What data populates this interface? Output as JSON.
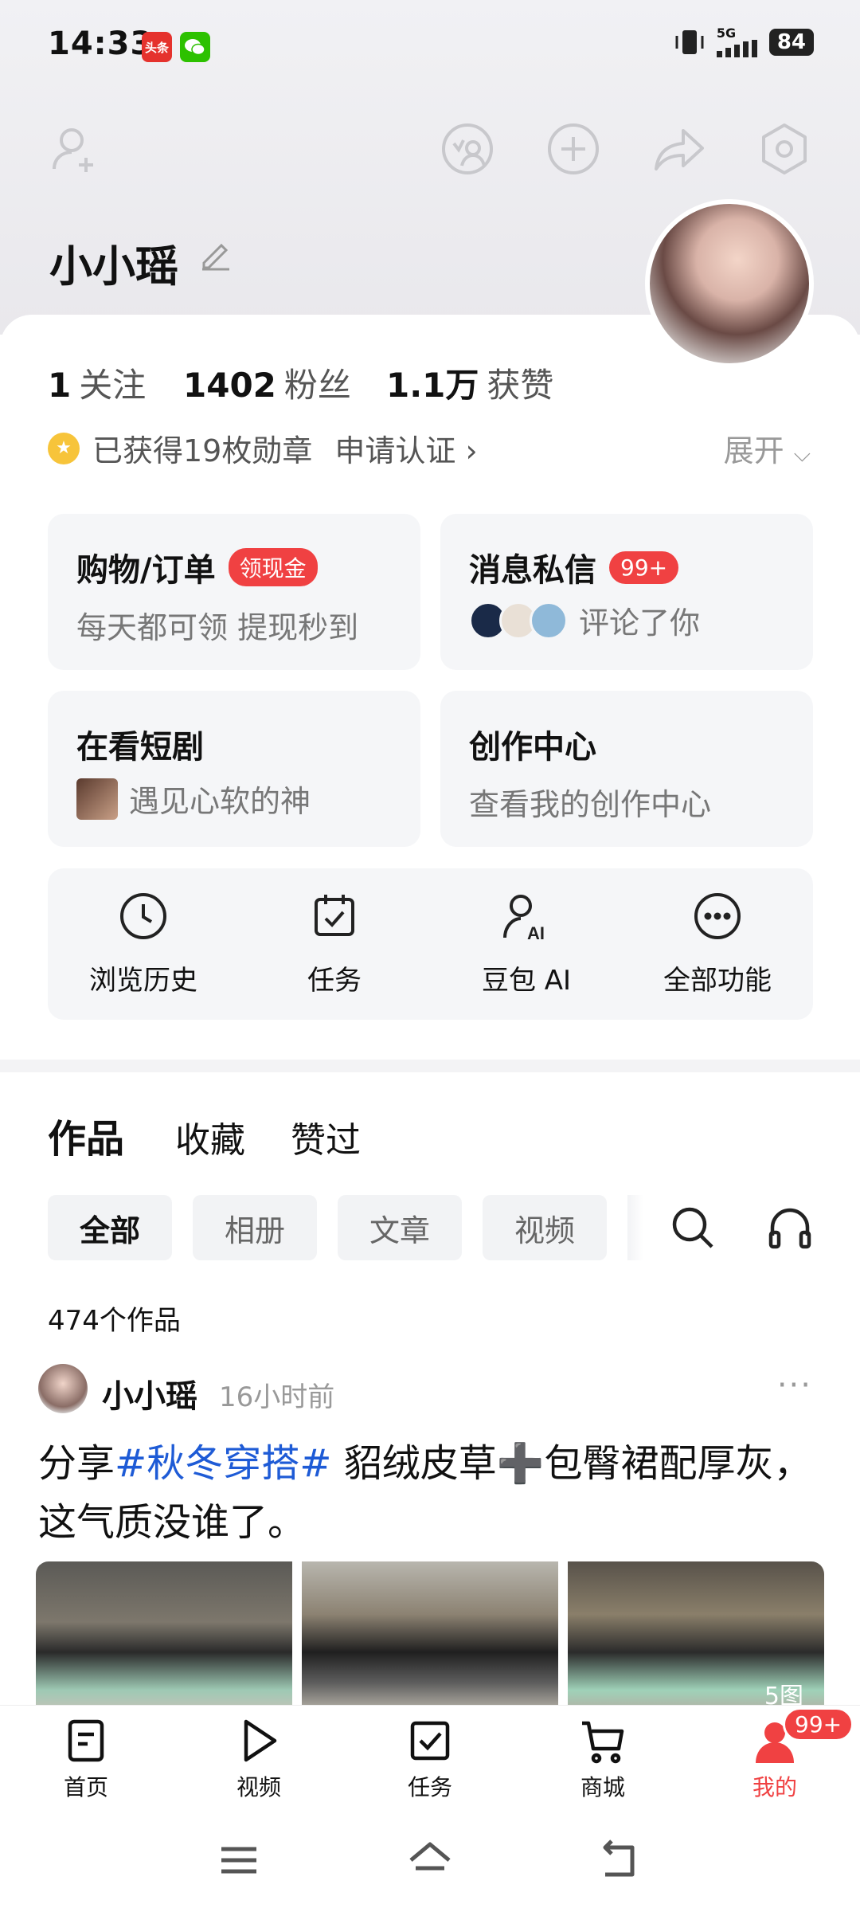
{
  "status": {
    "time": "14:33",
    "network": "5G",
    "battery": "84",
    "app1": "头条"
  },
  "profile": {
    "name": "小小瑶",
    "following": {
      "value": "1",
      "label": "关注"
    },
    "followers": {
      "value": "1402",
      "label": "粉丝"
    },
    "likes": {
      "value": "1.1万",
      "label": "获赞"
    },
    "badges_text": "已获得19枚勋章",
    "verify_text": "申请认证 ›",
    "expand_text": "展开"
  },
  "tiles": [
    {
      "title": "购物/订单",
      "tag": "领现金",
      "sub": "每天都可领 提现秒到"
    },
    {
      "title": "消息私信",
      "tag": "99+",
      "sub": "评论了你"
    },
    {
      "title": "在看短剧",
      "sub": "遇见心软的神"
    },
    {
      "title": "创作中心",
      "sub": "查看我的创作中心"
    }
  ],
  "functions": [
    {
      "label": "浏览历史",
      "icon": "clock-icon"
    },
    {
      "label": "任务",
      "icon": "calendar-check-icon"
    },
    {
      "label": "豆包 AI",
      "icon": "ai-person-icon"
    },
    {
      "label": "全部功能",
      "icon": "more-circle-icon"
    }
  ],
  "content_tabs": [
    "作品",
    "收藏",
    "赞过"
  ],
  "filters": [
    "全部",
    "相册",
    "文章",
    "视频"
  ],
  "post_count": "474个作品",
  "post": {
    "author": "小小瑶",
    "time": "16小时前",
    "text_before": "分享",
    "hashtag": "#秋冬穿搭#",
    "text_after": " 貂绒皮草➕包臀裙配厚灰，这气质没谁了。",
    "image_count": "5图"
  },
  "bottom_nav": [
    {
      "label": "首页",
      "icon": "home-doc-icon"
    },
    {
      "label": "视频",
      "icon": "play-icon"
    },
    {
      "label": "任务",
      "icon": "task-check-icon"
    },
    {
      "label": "商城",
      "icon": "cart-icon"
    },
    {
      "label": "我的",
      "icon": "user-icon",
      "badge": "99+"
    }
  ],
  "colors": {
    "accent_red": "#f04142",
    "hashtag_blue": "#1e5bd6",
    "medal_gold": "#f7c43a"
  }
}
